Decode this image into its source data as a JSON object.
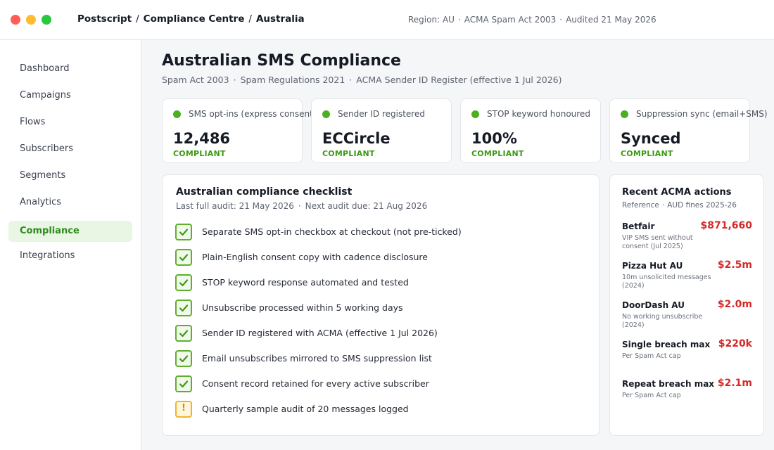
{
  "topbar": {
    "breadcrumb": [
      "Postscript",
      "Compliance Centre",
      "Australia"
    ],
    "meta": [
      "Region: AU",
      "ACMA Spam Act 2003",
      "Audited 21 May 2026"
    ]
  },
  "sidebar": {
    "items": [
      {
        "label": "Dashboard",
        "active": false
      },
      {
        "label": "Campaigns",
        "active": false
      },
      {
        "label": "Flows",
        "active": false
      },
      {
        "label": "Subscribers",
        "active": false
      },
      {
        "label": "Segments",
        "active": false
      },
      {
        "label": "Analytics",
        "active": false
      },
      {
        "label": "Compliance",
        "active": true
      },
      {
        "label": "Integrations",
        "active": false
      }
    ]
  },
  "page": {
    "title": "Australian SMS Compliance",
    "subtitle": [
      "Spam Act 2003",
      "Spam Regulations 2021",
      "ACMA Sender ID Register (effective 1 Jul 2026)"
    ]
  },
  "stats": [
    {
      "label": "SMS opt-ins (express consent)",
      "value": "12,486",
      "status": "COMPLIANT"
    },
    {
      "label": "Sender ID registered",
      "value": "ECCircle",
      "status": "COMPLIANT"
    },
    {
      "label": "STOP keyword honoured",
      "value": "100%",
      "status": "COMPLIANT"
    },
    {
      "label": "Suppression sync (email+SMS)",
      "value": "Synced",
      "status": "COMPLIANT"
    }
  ],
  "checklist": {
    "title": "Australian compliance checklist",
    "last_audit": "Last full audit: 21 May 2026",
    "next_audit": "Next audit due: 21 Aug 2026",
    "items": [
      {
        "label": "Separate SMS opt-in checkbox at checkout (not pre-ticked)",
        "state": "done"
      },
      {
        "label": "Plain-English consent copy with cadence disclosure",
        "state": "done"
      },
      {
        "label": "STOP keyword response automated and tested",
        "state": "done"
      },
      {
        "label": "Unsubscribe processed within 5 working days",
        "state": "done"
      },
      {
        "label": "Sender ID registered with ACMA (effective 1 Jul 2026)",
        "state": "done"
      },
      {
        "label": "Email unsubscribes mirrored to SMS suppression list",
        "state": "done"
      },
      {
        "label": "Consent record retained for every active subscriber",
        "state": "done"
      },
      {
        "label": "Quarterly sample audit of 20 messages logged",
        "state": "warning"
      }
    ],
    "warning_glyph": "!"
  },
  "actions": {
    "title": "Recent ACMA actions",
    "sub": [
      "Reference",
      "AUD fines 2025-26"
    ],
    "items": [
      {
        "name": "Betfair",
        "amount": "$871,660",
        "desc": "VIP SMS sent without consent (Jul 2025)"
      },
      {
        "name": "Pizza Hut AU",
        "amount": "$2.5m",
        "desc": "10m unsolicited messages (2024)"
      },
      {
        "name": "DoorDash AU",
        "amount": "$2.0m",
        "desc": "No working unsubscribe (2024)"
      },
      {
        "name": "Single breach max",
        "amount": "$220k",
        "desc": "Per Spam Act cap"
      },
      {
        "name": "Repeat breach max",
        "amount": "$2.1m",
        "desc": "Per Spam Act cap"
      }
    ]
  },
  "colors": {
    "accent_green": "#4caf1f",
    "status_green": "#3c9a14",
    "fine_red": "#d62828",
    "warning_amber": "#f0b429"
  }
}
